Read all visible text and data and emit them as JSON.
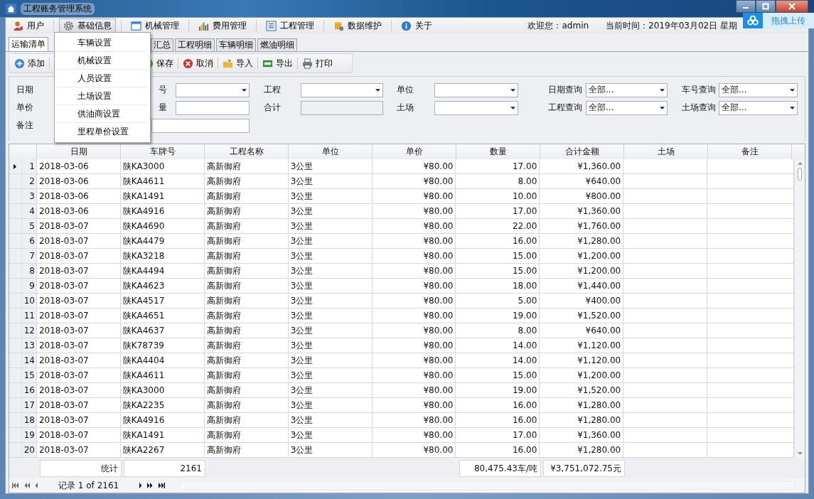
{
  "window": {
    "title": "工程账务管理系统"
  },
  "upload_widget": {
    "label": "拖拽上传"
  },
  "menu": [
    {
      "label": "用户",
      "selected": false
    },
    {
      "label": "基础信息",
      "selected": true
    },
    {
      "label": "机械管理",
      "selected": false
    },
    {
      "label": "费用管理",
      "selected": false
    },
    {
      "label": "工程管理",
      "selected": false
    },
    {
      "label": "数据维护",
      "selected": false
    },
    {
      "label": "关于",
      "selected": false
    }
  ],
  "welcome": "欢迎您：admin",
  "current_time": "当前时间：2019年03月02日 星期",
  "dropdown": [
    "车辆设置",
    "机械设置",
    "人员设置",
    "土场设置",
    "供油商设置",
    "里程单价设置"
  ],
  "tabs": [
    {
      "label": "运输清单",
      "selected": true
    },
    {
      "label": "汇总",
      "selected": false
    },
    {
      "label": "工程明细",
      "selected": false
    },
    {
      "label": "车辆明细",
      "selected": false
    },
    {
      "label": "燃油明细",
      "selected": false
    }
  ],
  "toolbar": [
    "添加",
    "保存",
    "取消",
    "导入",
    "导出",
    "打印"
  ],
  "form": [
    [
      {
        "label": "日期",
        "kind": "covered"
      },
      {
        "label": "号",
        "kind": "combo"
      },
      {
        "label": "工程",
        "kind": "combo"
      },
      {
        "label": "单位",
        "kind": "combo"
      },
      {
        "label": "日期查询",
        "kind": "combo",
        "value": "全部..."
      },
      {
        "label": "车号查询",
        "kind": "combo",
        "value": "全部..."
      }
    ],
    [
      {
        "label": "单价",
        "kind": "covered"
      },
      {
        "label": "量",
        "kind": "input"
      },
      {
        "label": "合计",
        "kind": "readonly"
      },
      {
        "label": "土场",
        "kind": "combo"
      },
      {
        "label": "工程查询",
        "kind": "combo",
        "value": "全部..."
      },
      {
        "label": "土场查询",
        "kind": "combo",
        "value": "全部..."
      }
    ],
    [
      {
        "label": "备注",
        "kind": "covered"
      },
      {
        "kind": "input"
      }
    ]
  ],
  "table": {
    "columns": [
      "日期",
      "车牌号",
      "工程名称",
      "单位",
      "单价",
      "数量",
      "合计金额",
      "土场",
      "备注"
    ],
    "rows": [
      {
        "number": "1",
        "current": true,
        "cells": [
          "2018-03-06",
          "陕KA3000",
          "高新御府",
          "3公里",
          "¥80.00",
          "17.00",
          "¥1,360.00"
        ]
      },
      {
        "number": "2",
        "current": false,
        "cells": [
          "2018-03-06",
          "陕KA4611",
          "高新御府",
          "3公里",
          "¥80.00",
          "8.00",
          "¥640.00"
        ]
      },
      {
        "number": "3",
        "current": false,
        "cells": [
          "2018-03-06",
          "陕KA1491",
          "高新御府",
          "3公里",
          "¥80.00",
          "10.00",
          "¥800.00"
        ]
      },
      {
        "number": "4",
        "current": false,
        "cells": [
          "2018-03-06",
          "陕KA4916",
          "高新御府",
          "3公里",
          "¥80.00",
          "17.00",
          "¥1,360.00"
        ]
      },
      {
        "number": "5",
        "current": false,
        "cells": [
          "2018-03-07",
          "陕KA4690",
          "高新御府",
          "3公里",
          "¥80.00",
          "22.00",
          "¥1,760.00"
        ]
      },
      {
        "number": "6",
        "current": false,
        "cells": [
          "2018-03-07",
          "陕KA4479",
          "高新御府",
          "3公里",
          "¥80.00",
          "16.00",
          "¥1,280.00"
        ]
      },
      {
        "number": "7",
        "current": false,
        "cells": [
          "2018-03-07",
          "陕KA3218",
          "高新御府",
          "3公里",
          "¥80.00",
          "15.00",
          "¥1,200.00"
        ]
      },
      {
        "number": "8",
        "current": false,
        "cells": [
          "2018-03-07",
          "陕KA4494",
          "高新御府",
          "3公里",
          "¥80.00",
          "15.00",
          "¥1,200.00"
        ]
      },
      {
        "number": "9",
        "current": false,
        "cells": [
          "2018-03-07",
          "陕KA4623",
          "高新御府",
          "3公里",
          "¥80.00",
          "18.00",
          "¥1,440.00"
        ]
      },
      {
        "number": "10",
        "current": false,
        "cells": [
          "2018-03-07",
          "陕KA4517",
          "高新御府",
          "3公里",
          "¥80.00",
          "5.00",
          "¥400.00"
        ]
      },
      {
        "number": "11",
        "current": false,
        "cells": [
          "2018-03-07",
          "陕KA4651",
          "高新御府",
          "3公里",
          "¥80.00",
          "19.00",
          "¥1,520.00"
        ]
      },
      {
        "number": "12",
        "current": false,
        "cells": [
          "2018-03-07",
          "陕KA4637",
          "高新御府",
          "3公里",
          "¥80.00",
          "8.00",
          "¥640.00"
        ]
      },
      {
        "number": "13",
        "current": false,
        "cells": [
          "2018-03-07",
          "陕K78739",
          "高新御府",
          "3公里",
          "¥80.00",
          "14.00",
          "¥1,120.00"
        ]
      },
      {
        "number": "14",
        "current": false,
        "cells": [
          "2018-03-07",
          "陕KA4404",
          "高新御府",
          "3公里",
          "¥80.00",
          "14.00",
          "¥1,120.00"
        ]
      },
      {
        "number": "15",
        "current": false,
        "cells": [
          "2018-03-07",
          "陕KA4611",
          "高新御府",
          "3公里",
          "¥80.00",
          "15.00",
          "¥1,200.00"
        ]
      },
      {
        "number": "16",
        "current": false,
        "cells": [
          "2018-03-07",
          "陕KA3000",
          "高新御府",
          "3公里",
          "¥80.00",
          "19.00",
          "¥1,520.00"
        ]
      },
      {
        "number": "17",
        "current": false,
        "cells": [
          "2018-03-07",
          "陕KA2235",
          "高新御府",
          "3公里",
          "¥80.00",
          "16.00",
          "¥1,280.00"
        ]
      },
      {
        "number": "18",
        "current": false,
        "cells": [
          "2018-03-07",
          "陕KA4916",
          "高新御府",
          "3公里",
          "¥80.00",
          "16.00",
          "¥1,280.00"
        ]
      },
      {
        "number": "19",
        "current": false,
        "cells": [
          "2018-03-07",
          "陕KA1491",
          "高新御府",
          "3公里",
          "¥80.00",
          "17.00",
          "¥1,360.00"
        ]
      },
      {
        "number": "20",
        "current": false,
        "cells": [
          "2018-03-07",
          "陕KA2267",
          "高新御府",
          "3公里",
          "¥80.00",
          "16.00",
          "¥1,280.00"
        ]
      }
    ],
    "summary": {
      "date": "统计",
      "plate": "2161",
      "quantity": "80,475.43车/吨",
      "amount": "¥3,751,072.75元"
    }
  },
  "navigator": {
    "record": "记录 1 of 2161"
  }
}
